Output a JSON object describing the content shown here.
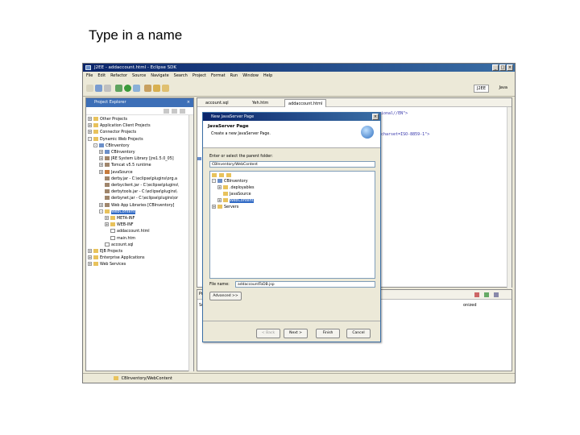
{
  "slide_title": "Type in a name",
  "window": {
    "title": "J2EE - addaccount.html - Eclipse SDK",
    "buttons": [
      "_",
      "□",
      "×"
    ]
  },
  "menu": [
    "File",
    "Edit",
    "Refactor",
    "Source",
    "Navigate",
    "Search",
    "Project",
    "Format",
    "Run",
    "Window",
    "Help"
  ],
  "perspective": {
    "active": "J2EE",
    "other": "Java"
  },
  "project_explorer": {
    "title": "Project Explorer",
    "items": [
      {
        "label": "Other Projects",
        "indent": 0,
        "exp": "+",
        "icon": "folder"
      },
      {
        "label": "Application Client Projects",
        "indent": 0,
        "exp": "+",
        "icon": "folder"
      },
      {
        "label": "Connector Projects",
        "indent": 0,
        "exp": "+",
        "icon": "folder"
      },
      {
        "label": "Dynamic Web Projects",
        "indent": 0,
        "exp": "-",
        "icon": "folder"
      },
      {
        "label": "CBInventory",
        "indent": 1,
        "exp": "-",
        "icon": "proj"
      },
      {
        "label": "CBInventory",
        "indent": 2,
        "exp": "+",
        "icon": "proj"
      },
      {
        "label": "JRE System Library [jre1.5.0_05]",
        "indent": 2,
        "exp": "+",
        "icon": "jar"
      },
      {
        "label": "Tomcat v5.5 runtime",
        "indent": 2,
        "exp": "+",
        "icon": "jar"
      },
      {
        "label": "JavaSource",
        "indent": 2,
        "exp": "+",
        "icon": "pkg"
      },
      {
        "label": "derby.jar - C:\\eclipse\\plugins\\org.a",
        "indent": 2,
        "exp": "",
        "icon": "jar"
      },
      {
        "label": "derbyclient.jar - C:\\eclipse\\plugins\\",
        "indent": 2,
        "exp": "",
        "icon": "jar"
      },
      {
        "label": "derbytools.jar - C:\\eclipse\\plugins\\",
        "indent": 2,
        "exp": "",
        "icon": "jar"
      },
      {
        "label": "derbynet.jar - C:\\eclipse\\plugins\\or",
        "indent": 2,
        "exp": "",
        "icon": "jar"
      },
      {
        "label": "Web App Libraries [CBInventory]",
        "indent": 2,
        "exp": "+",
        "icon": "jar"
      },
      {
        "label": "WebContent",
        "indent": 2,
        "exp": "-",
        "icon": "folder",
        "selected": true
      },
      {
        "label": "META-INF",
        "indent": 3,
        "exp": "+",
        "icon": "folder"
      },
      {
        "label": "WEB-INF",
        "indent": 3,
        "exp": "+",
        "icon": "folder"
      },
      {
        "label": "addaccount.html",
        "indent": 3,
        "exp": "",
        "icon": "file"
      },
      {
        "label": "main.htm",
        "indent": 3,
        "exp": "",
        "icon": "file"
      },
      {
        "label": "account.sql",
        "indent": 2,
        "exp": "",
        "icon": "file"
      },
      {
        "label": "EJB Projects",
        "indent": 0,
        "exp": "+",
        "icon": "folder"
      },
      {
        "label": "Enterprise Applications",
        "indent": 0,
        "exp": "+",
        "icon": "folder"
      },
      {
        "label": "Web Services",
        "indent": 0,
        "exp": "+",
        "icon": "folder"
      }
    ]
  },
  "editor": {
    "tabs": [
      "account.sql",
      "Yeh.htm",
      "addaccount.html"
    ],
    "code_lines": [
      "ional//EN\">",
      "charset=ISO-8859-1\">"
    ]
  },
  "bottom_panel": {
    "tab": "Pro",
    "row": "Se",
    "col_label": "onized"
  },
  "status_bar": {
    "path": "CBInventory/WebContent"
  },
  "dialog": {
    "title": "New JavaServer Page",
    "header": "JavaServer Page",
    "description": "Create a new JavaServer Page.",
    "parent_label": "Enter or select the parent folder:",
    "parent_value": "CBInventory/WebContent",
    "tree": [
      {
        "label": "CBInventory",
        "indent": 0,
        "exp": "-",
        "icon": "proj"
      },
      {
        "label": ".deployables",
        "indent": 1,
        "exp": "+",
        "icon": "folder"
      },
      {
        "label": "JavaSource",
        "indent": 1,
        "exp": "",
        "icon": "folder"
      },
      {
        "label": "WebContent",
        "indent": 1,
        "exp": "+",
        "icon": "folder",
        "selected": true
      },
      {
        "label": "Servers",
        "indent": 0,
        "exp": "+",
        "icon": "folder"
      }
    ],
    "filename_label": "File name:",
    "filename_value": "addaccountToDB.jsp",
    "advanced_label": "Advanced >>",
    "buttons": {
      "back": "< Back",
      "next": "Next >",
      "finish": "Finish",
      "cancel": "Cancel"
    }
  }
}
